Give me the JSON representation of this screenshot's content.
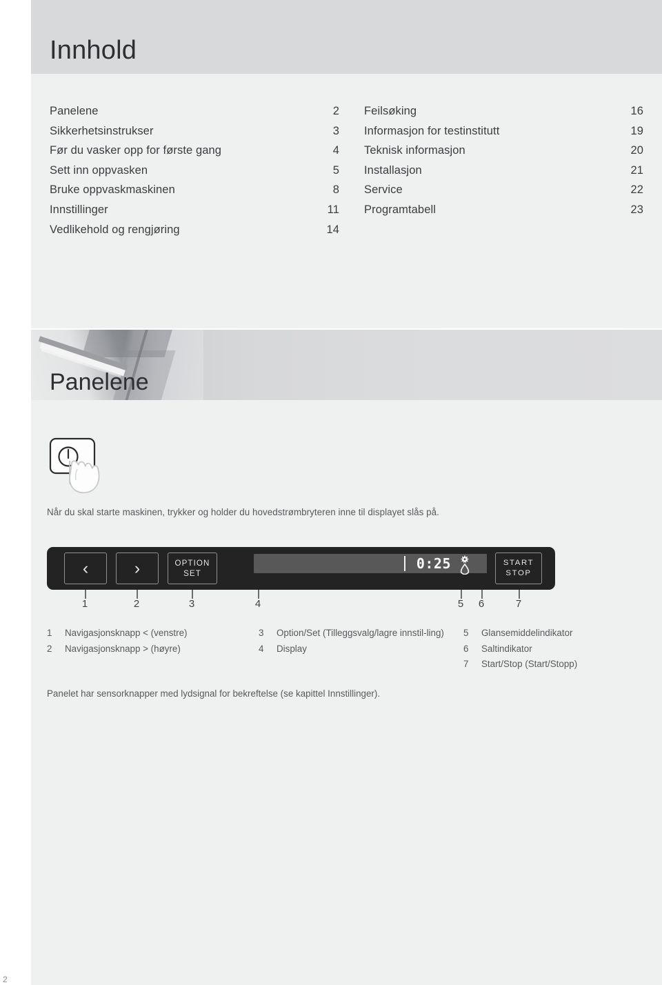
{
  "document": {
    "folio": "2"
  },
  "toc": {
    "title": "Innhold",
    "left_entries": [
      {
        "label": "Panelene",
        "page": "2"
      },
      {
        "label": "Sikkerhetsinstrukser",
        "page": "3"
      },
      {
        "label": "Før du vasker opp for første gang",
        "page": "4"
      },
      {
        "label": "Sett inn oppvasken",
        "page": "5"
      },
      {
        "label": "Bruke oppvaskmaskinen",
        "page": "8"
      },
      {
        "label": "Innstillinger",
        "page": "11"
      },
      {
        "label": "Vedlikehold og rengjøring",
        "page": "14"
      }
    ],
    "right_entries": [
      {
        "label": "Feilsøking",
        "page": "16"
      },
      {
        "label": "Informasjon for testinstitutt",
        "page": "19"
      },
      {
        "label": "Teknisk informasjon",
        "page": "20"
      },
      {
        "label": "Installasjon",
        "page": "21"
      },
      {
        "label": "Service",
        "page": "22"
      },
      {
        "label": "Programtabell",
        "page": "23"
      }
    ]
  },
  "panel_section": {
    "heading": "Panelene",
    "start_caption": "Når du skal starte maskinen, trykker og holder du hovedstrømbryteren inne til displayet slås på.",
    "note": "Panelet har sensorknapper med lydsignal for bekreftelse (se kapittel Innstillinger).",
    "control_panel": {
      "button_left": "‹",
      "button_right": "›",
      "option_line1": "OPTION",
      "option_line2": "SET",
      "display_time": "0:25",
      "startstop_line1": "START",
      "startstop_line2": "STOP"
    },
    "callout_numbers": [
      "1",
      "2",
      "3",
      "4",
      "5",
      "6",
      "7"
    ],
    "legend_col1": [
      {
        "n": "1",
        "text": "Navigasjonsknapp < (venstre)"
      },
      {
        "n": "2",
        "text": "Navigasjonsknapp > (høyre)"
      }
    ],
    "legend_col2": [
      {
        "n": "3",
        "text": "Option/Set (Tilleggsvalg/lagre innstil-ling)"
      },
      {
        "n": "4",
        "text": "Display"
      }
    ],
    "legend_col3": [
      {
        "n": "5",
        "text": "Glansemiddelindikator"
      },
      {
        "n": "6",
        "text": "Saltindikator"
      },
      {
        "n": "7",
        "text": "Start/Stop (Start/Stopp)"
      }
    ]
  },
  "colors": {
    "band": "#d8d9db",
    "page_bg": "#eff0f0",
    "panel_dark": "#232323",
    "text": "#3b3c3f"
  }
}
